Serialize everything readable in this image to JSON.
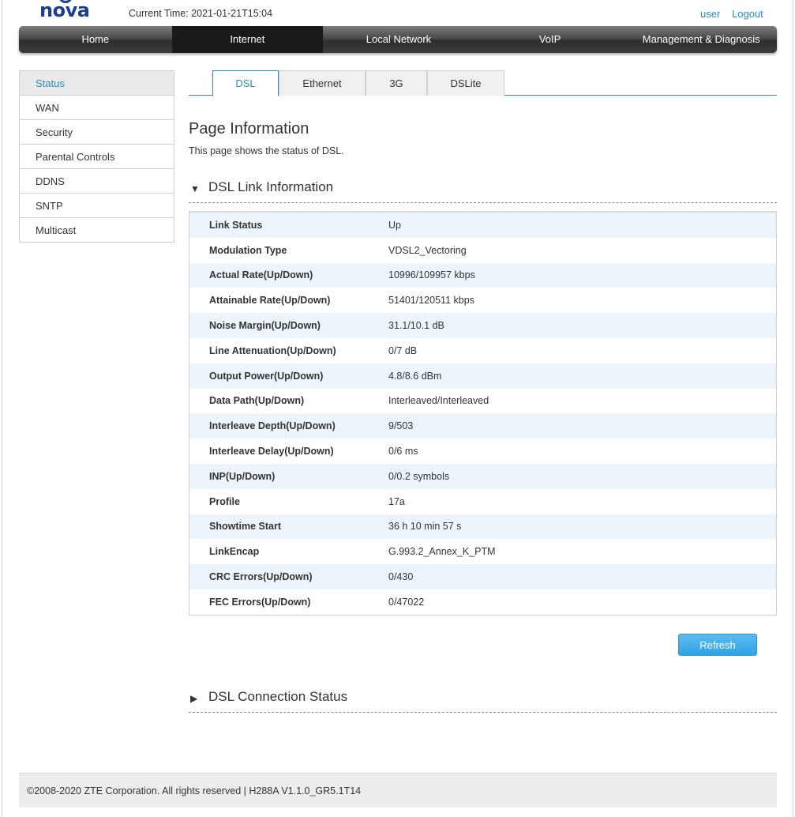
{
  "header": {
    "logo": "nova",
    "current_time": "Current Time: 2021-01-21T15:04",
    "user_link": "user",
    "logout_link": "Logout"
  },
  "topnav": {
    "items": [
      {
        "label": "Home"
      },
      {
        "label": "Internet"
      },
      {
        "label": "Local Network"
      },
      {
        "label": "VoIP"
      },
      {
        "label": "Management & Diagnosis"
      }
    ],
    "active": "Internet"
  },
  "sidebar": {
    "items": [
      {
        "label": "Status"
      },
      {
        "label": "WAN"
      },
      {
        "label": "Security"
      },
      {
        "label": "Parental Controls"
      },
      {
        "label": "DDNS"
      },
      {
        "label": "SNTP"
      },
      {
        "label": "Multicast"
      }
    ],
    "active": "Status"
  },
  "tabs": {
    "items": [
      {
        "label": "DSL"
      },
      {
        "label": "Ethernet"
      },
      {
        "label": "3G"
      },
      {
        "label": "DSLite"
      }
    ],
    "active": "DSL"
  },
  "page": {
    "title": "Page Information",
    "description": "This page shows the status of DSL."
  },
  "dsl_link": {
    "heading": "DSL Link Information",
    "expanded": true,
    "rows": [
      {
        "label": "Link Status",
        "value": "Up"
      },
      {
        "label": "Modulation Type",
        "value": "VDSL2_Vectoring"
      },
      {
        "label": "Actual Rate(Up/Down)",
        "value": "10996/109957 kbps"
      },
      {
        "label": "Attainable Rate(Up/Down)",
        "value": "51401/120511 kbps"
      },
      {
        "label": "Noise Margin(Up/Down)",
        "value": "31.1/10.1 dB"
      },
      {
        "label": "Line Attenuation(Up/Down)",
        "value": "0/7 dB"
      },
      {
        "label": "Output Power(Up/Down)",
        "value": "4.8/8.6 dBm"
      },
      {
        "label": "Data Path(Up/Down)",
        "value": "Interleaved/Interleaved"
      },
      {
        "label": "Interleave Depth(Up/Down)",
        "value": "9/503"
      },
      {
        "label": "Interleave Delay(Up/Down)",
        "value": "0/6 ms"
      },
      {
        "label": "INP(Up/Down)",
        "value": "0/0.2 symbols"
      },
      {
        "label": "Profile",
        "value": "17a"
      },
      {
        "label": "Showtime Start",
        "value": "36 h 10 min 57 s"
      },
      {
        "label": "LinkEncap",
        "value": "G.993.2_Annex_K_PTM"
      },
      {
        "label": "CRC Errors(Up/Down)",
        "value": "0/430"
      },
      {
        "label": "FEC Errors(Up/Down)",
        "value": "0/47022"
      }
    ]
  },
  "refresh_label": "Refresh",
  "dsl_connection": {
    "heading": "DSL Connection Status",
    "expanded": false
  },
  "footer": {
    "copyright": "©2008-2020 ZTE Corporation. All rights reserved  |   H288A V1.1.0_GR5.1T14"
  },
  "colors": {
    "accent": "#2a8ac6",
    "brand": "#1d3f8f",
    "row_alt": "#ecf5fc",
    "button": "#2fa3e3"
  }
}
